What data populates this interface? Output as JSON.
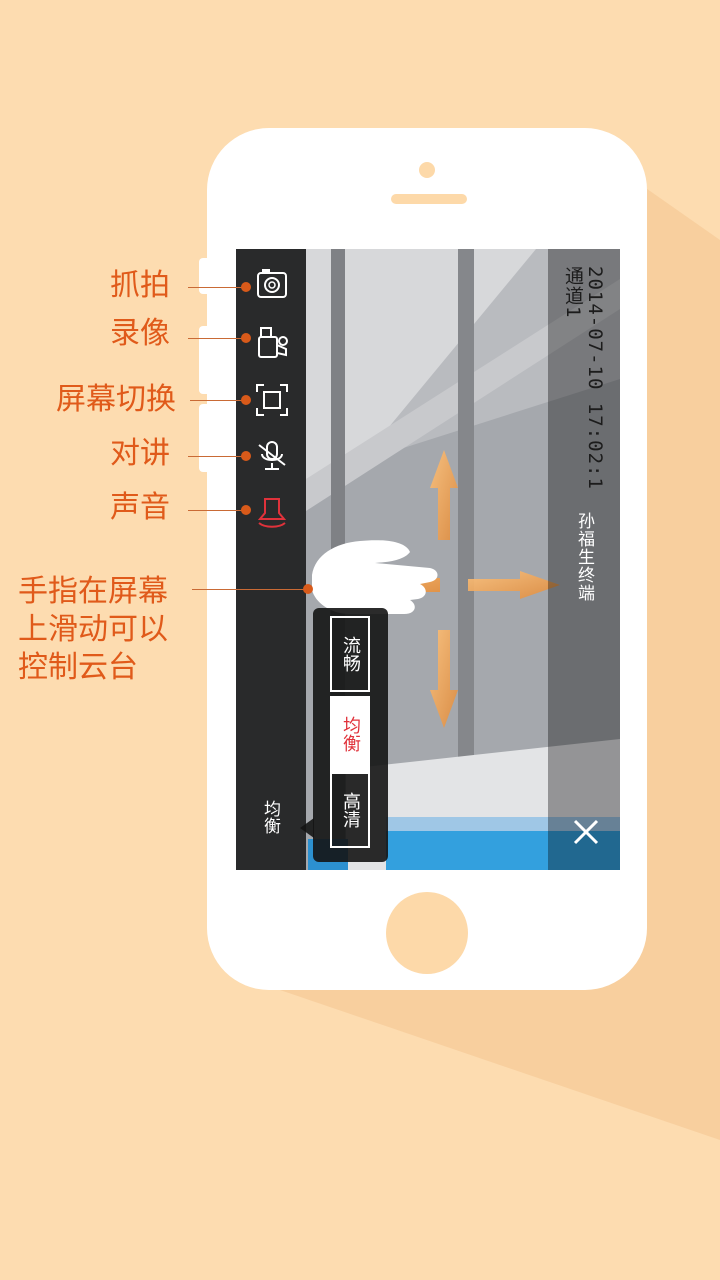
{
  "annotations": {
    "snapshot": "抓拍",
    "record": "录像",
    "screen_switch": "屏幕切换",
    "intercom": "对讲",
    "sound": "声音",
    "ptz_hint_line1": "手指在屏幕",
    "ptz_hint_line2": "上滑动可以",
    "ptz_hint_line3": "控制云台"
  },
  "osd": {
    "channel": "通道1",
    "timestamp": "2014-07-10 17:02:1",
    "device_name": "孙福生终端"
  },
  "quality": {
    "options": [
      "流畅",
      "均衡",
      "高清"
    ],
    "selected": "均衡",
    "current_label": "均衡"
  },
  "toolbar": {
    "icons": [
      "camera-icon",
      "video-camera-icon",
      "fullscreen-icon",
      "microphone-muted-icon",
      "speaker-icon"
    ]
  },
  "colors": {
    "background": "#fddcb0",
    "annotation_text": "#e05a1a",
    "arrow": "#f0a050",
    "selected_text": "#e0323b",
    "speaker_icon": "#e0323b"
  }
}
